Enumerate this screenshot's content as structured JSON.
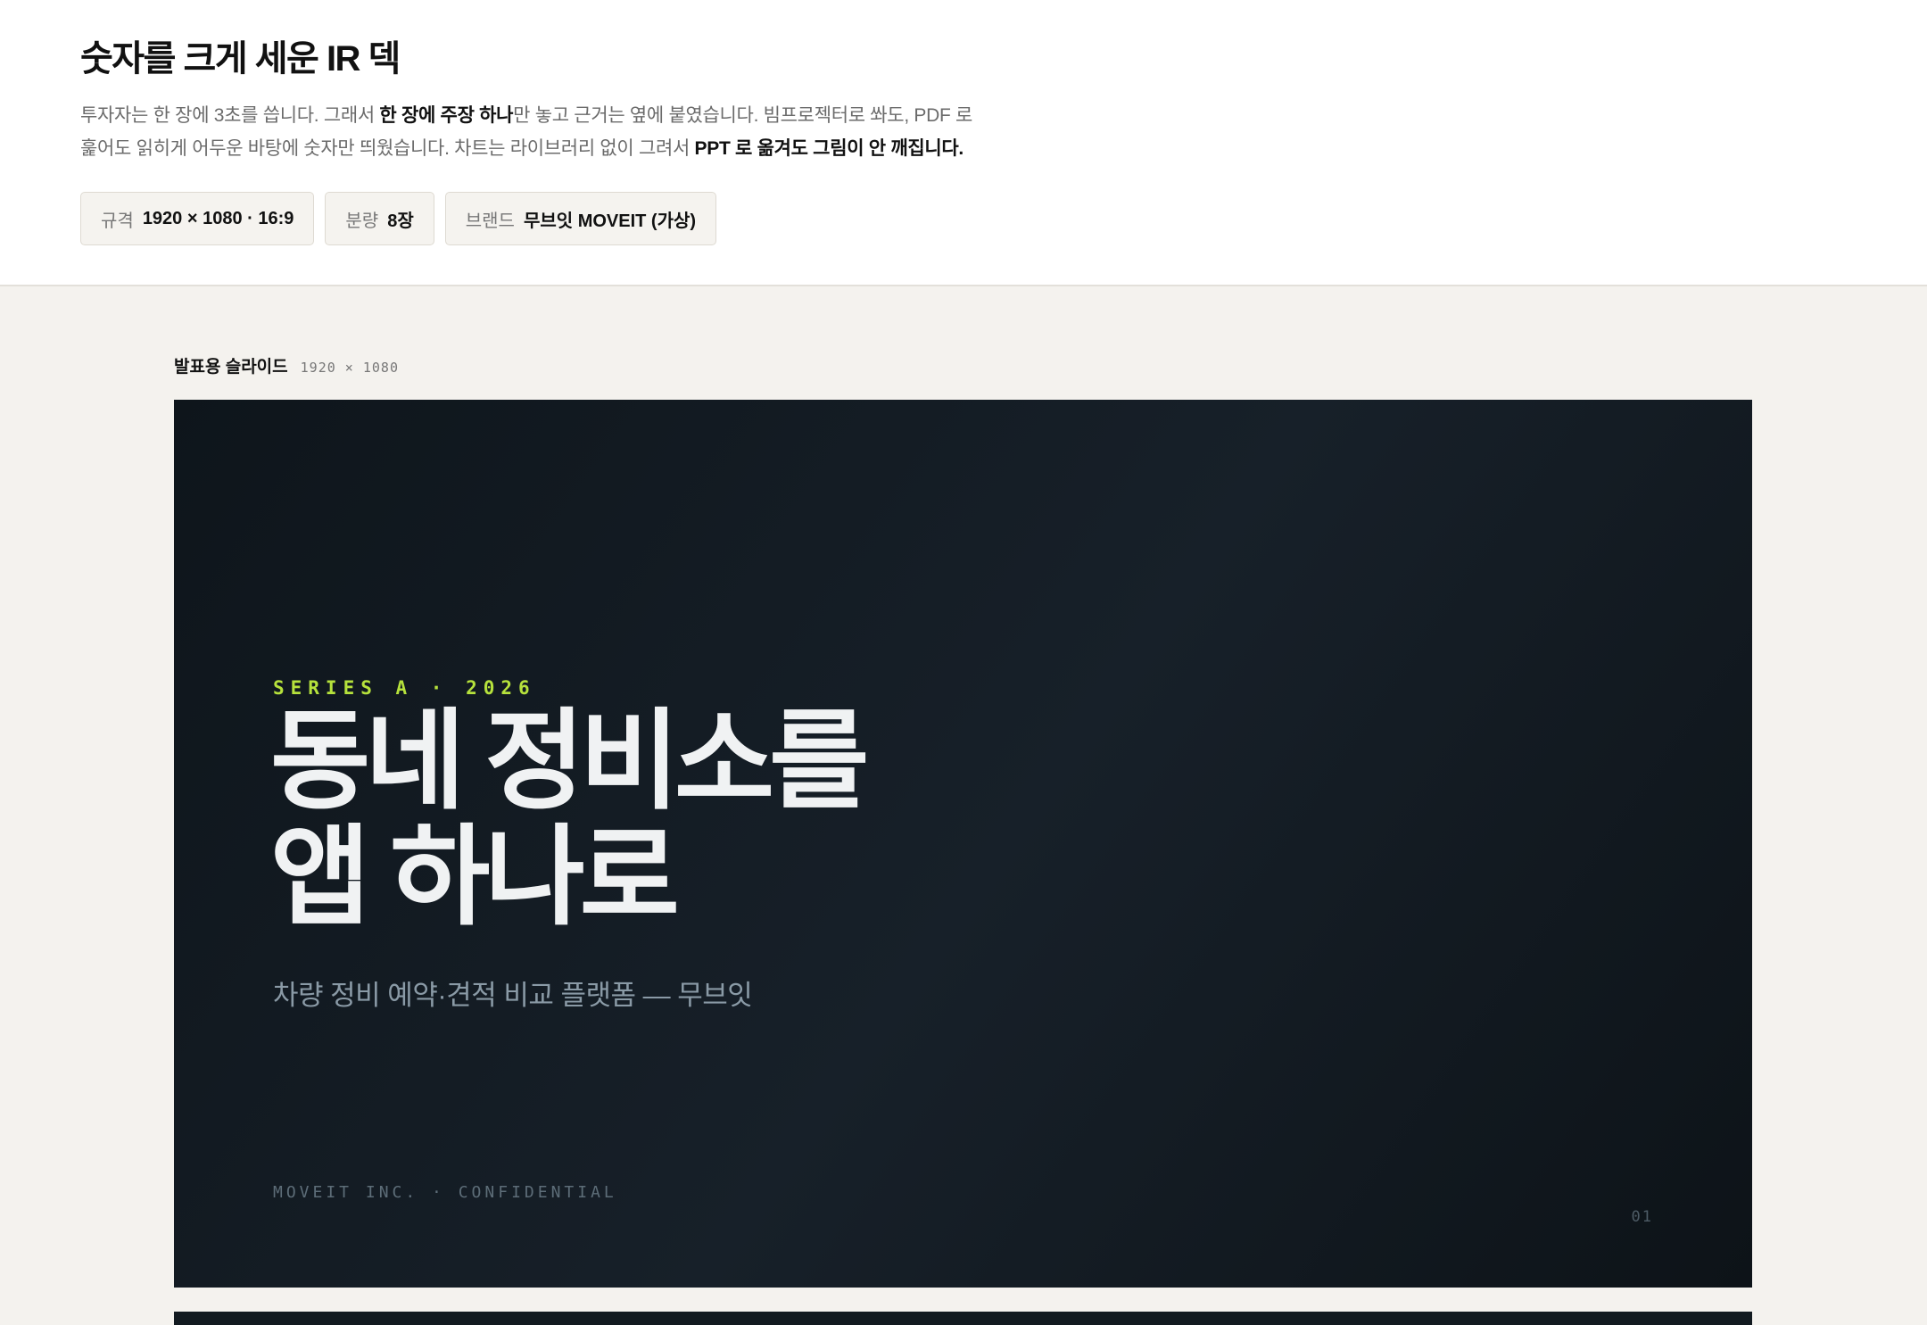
{
  "header": {
    "title": "숫자를 크게 세운 IR 덱",
    "intro": {
      "line1_a": "투자자는 한 장에 3초를 씁니다. 그래서 ",
      "line1_b": "한 장에 주장 하나",
      "line1_c": "만 놓고 근거는 옆에 붙였습니다. 빔프로젝터로 쏴도, PDF 로",
      "line2_a": "훑어도 읽히게 어두운 바탕에 숫자만 띄웠습니다. 차트는 라이브러리 없이 그려서 ",
      "line2_b": "PPT 로 옮겨도 그림이 안 깨집니다."
    },
    "chips": [
      {
        "key": "규격",
        "value": "1920 × 1080 · 16:9"
      },
      {
        "key": "분량",
        "value": "8장"
      },
      {
        "key": "브랜드",
        "value": "무브잇 MOVEIT (가상)"
      }
    ]
  },
  "slide_caption": {
    "label": "발표용 슬라이드",
    "dims": "1920 × 1080"
  },
  "slide": {
    "eyebrow": "SERIES A · 2026",
    "headline_line1": "동네 정비소를",
    "headline_line2": "앱 하나로",
    "subtitle": "차량 정비 예약·견적 비교 플랫폼 — 무브잇",
    "footer": "MOVEIT INC. · CONFIDENTIAL",
    "page_number": "01",
    "colors": {
      "background": "#141c23",
      "accent": "#b6e23c",
      "headline": "#f0f2f3",
      "subtitle": "#8a9aa6"
    }
  }
}
